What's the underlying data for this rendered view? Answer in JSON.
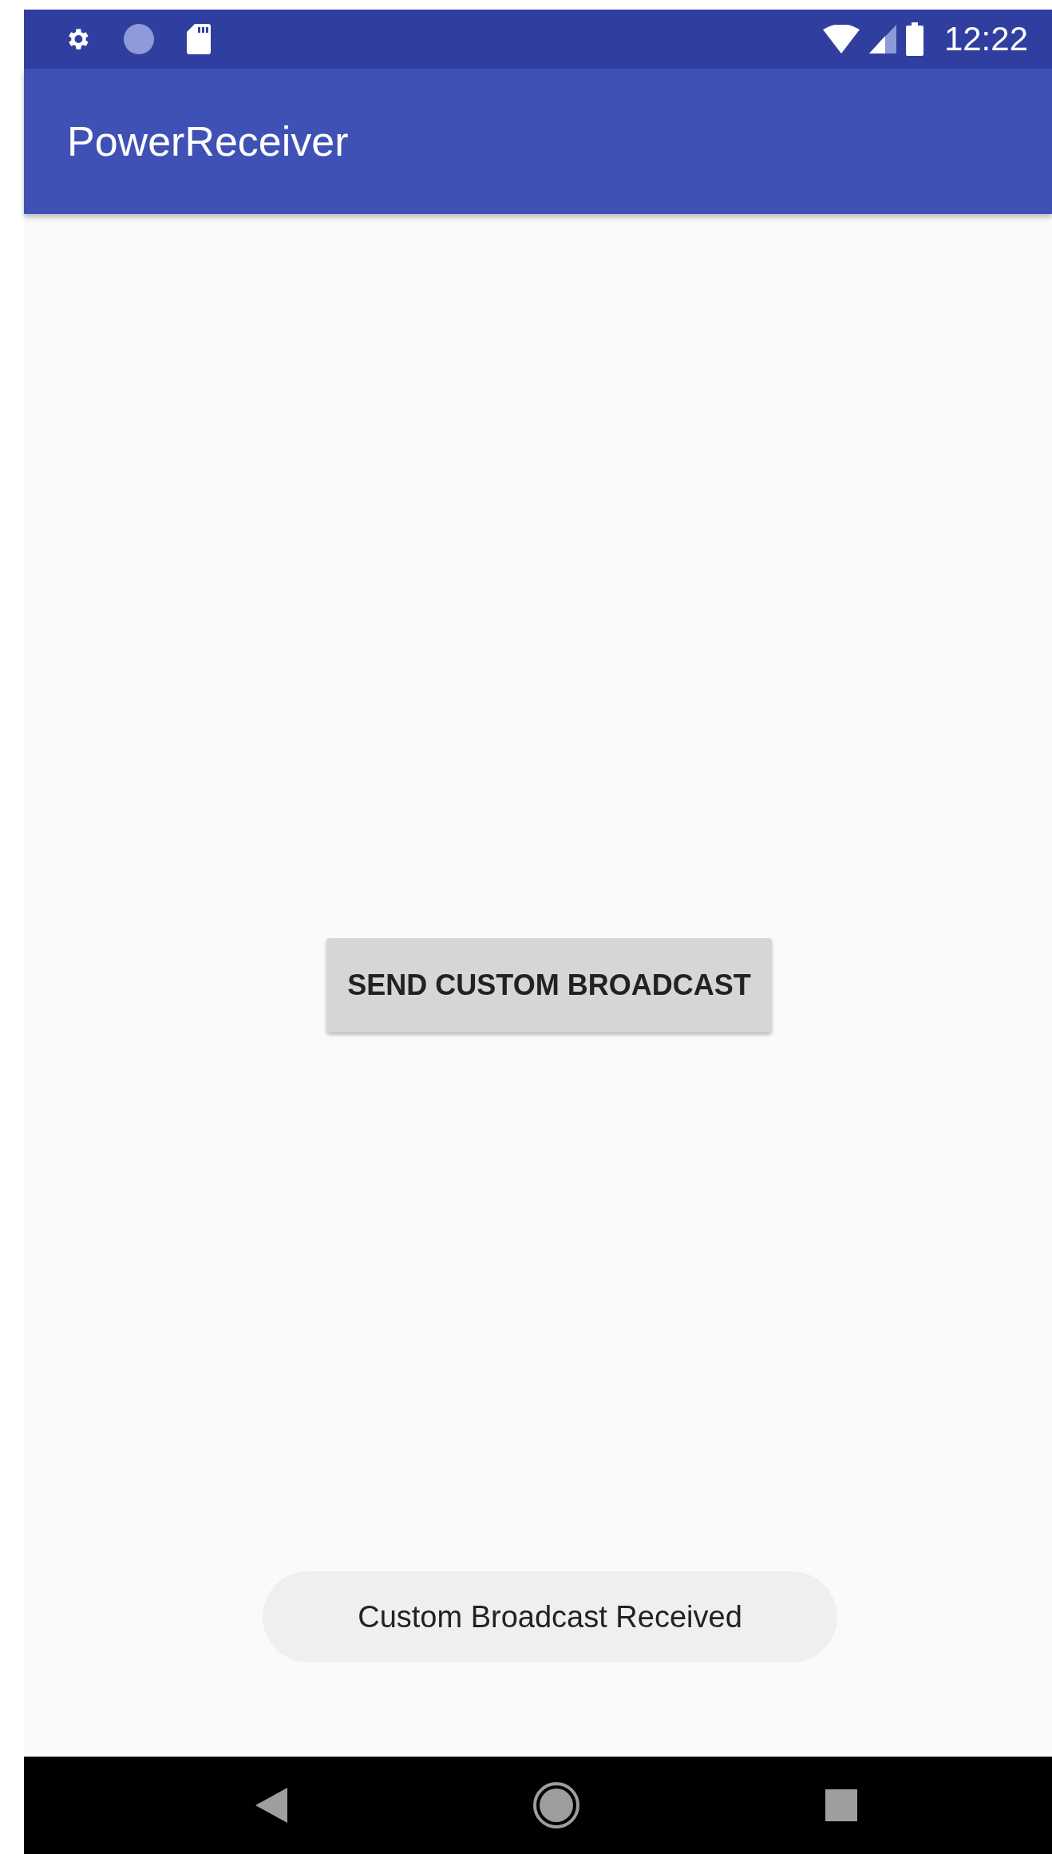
{
  "status_bar": {
    "time": "12:22"
  },
  "app_bar": {
    "title": "PowerReceiver"
  },
  "button": {
    "label": "SEND CUSTOM BROADCAST"
  },
  "toast": {
    "text": "Custom Broadcast Received"
  }
}
